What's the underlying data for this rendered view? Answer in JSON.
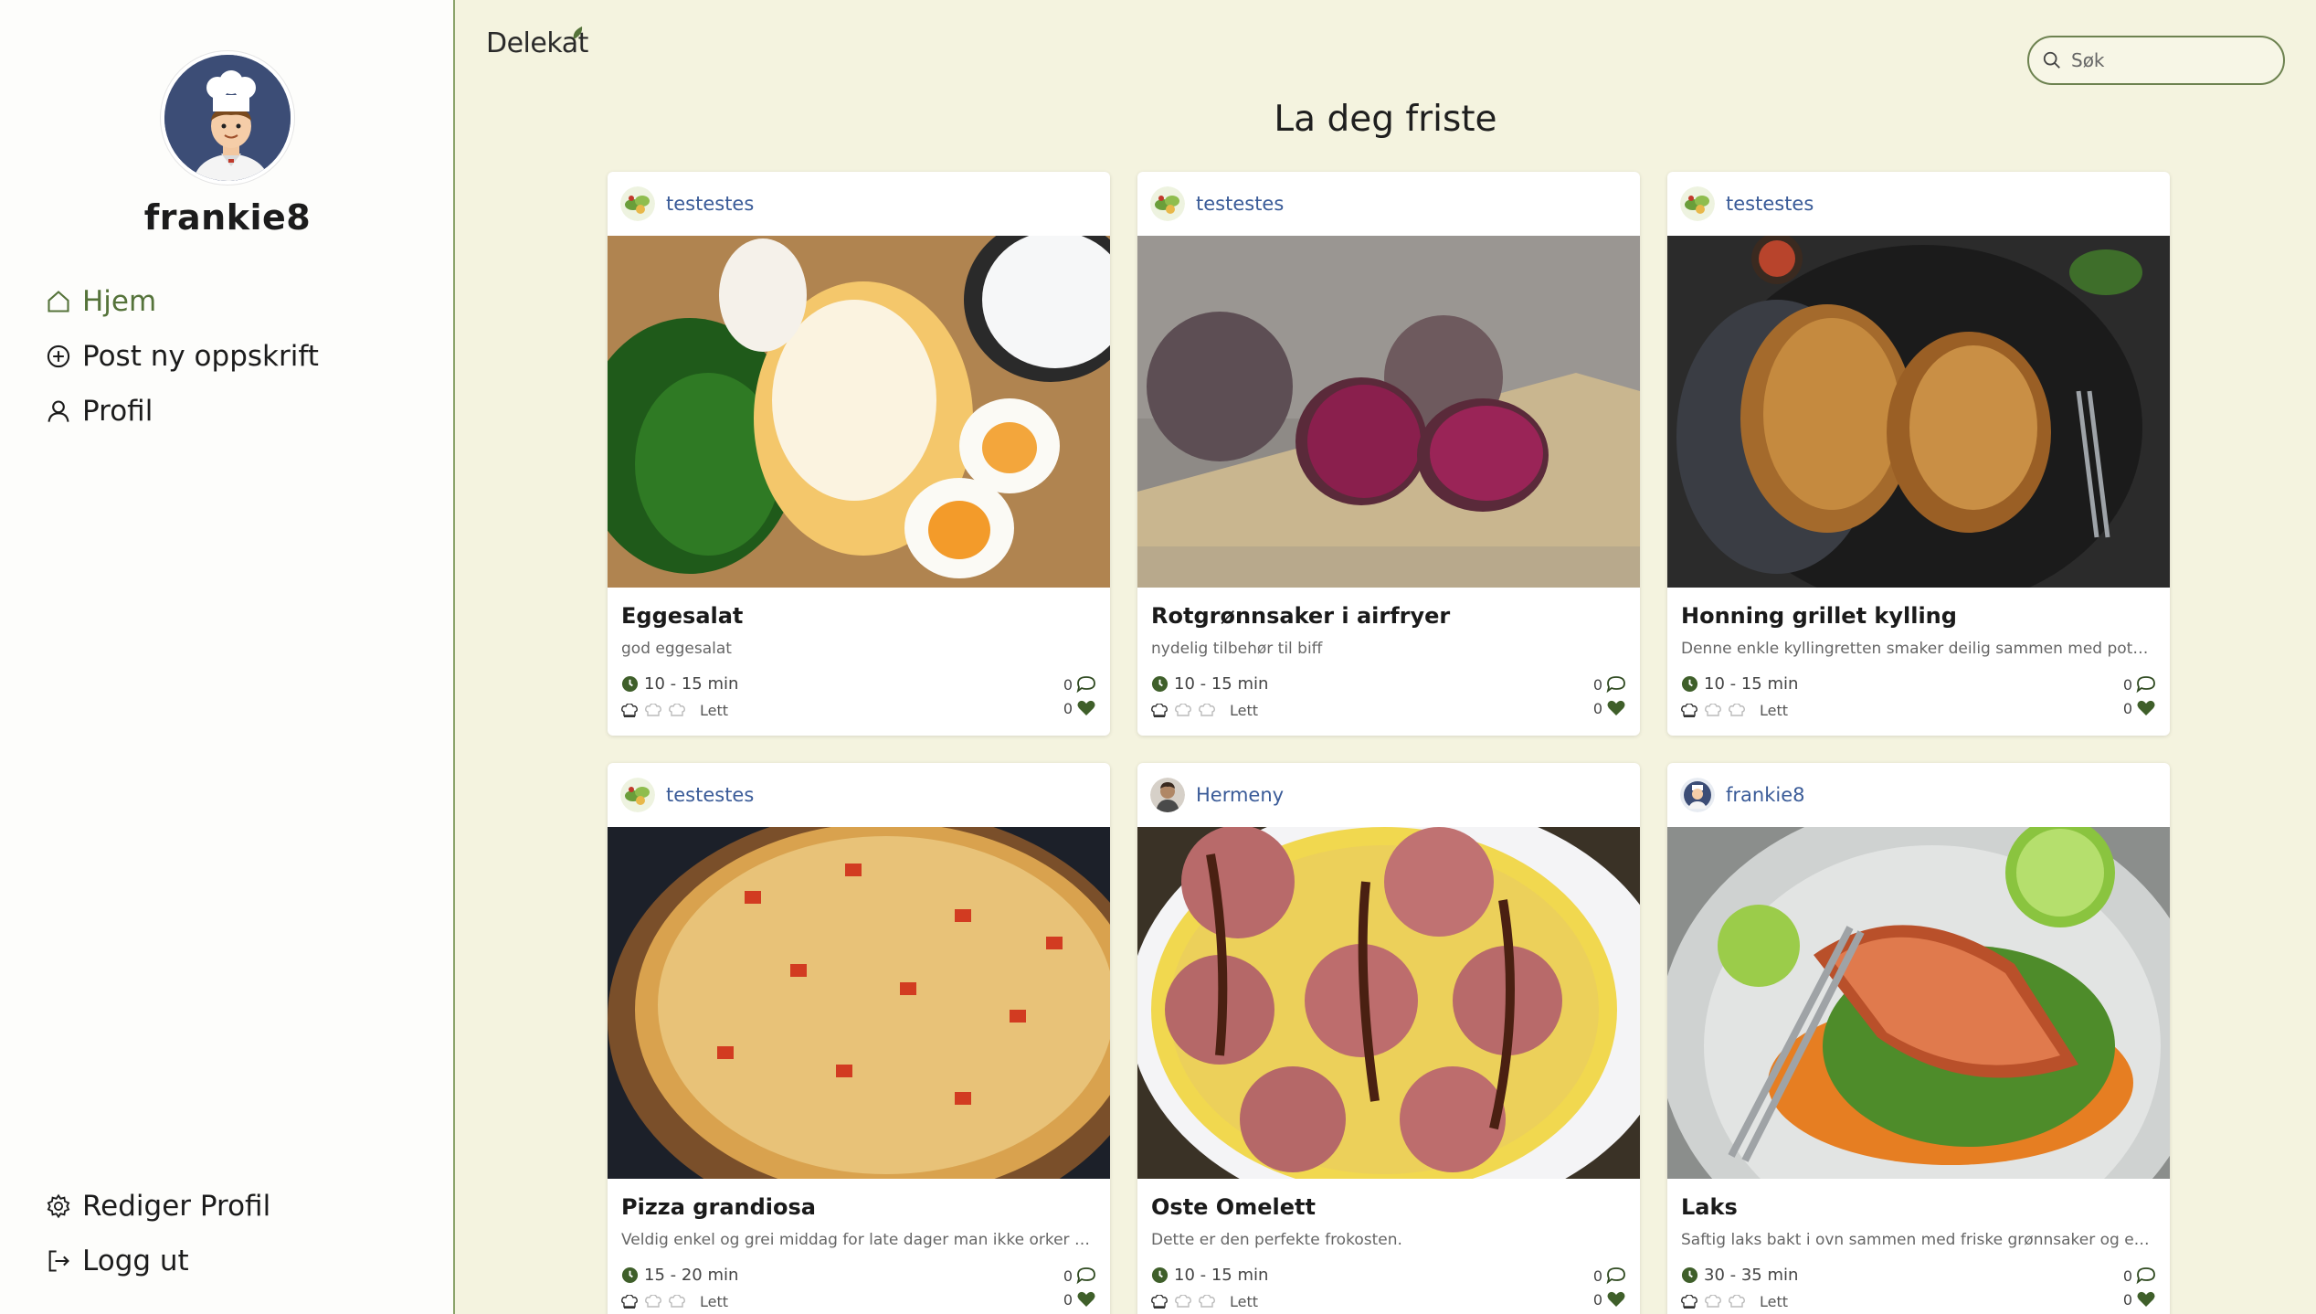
{
  "colors": {
    "accent": "#55733a",
    "background": "#f4f3df",
    "sidebar": "#fdfdfb",
    "link": "#3a5b98"
  },
  "sidebar": {
    "username": "frankie8",
    "nav": [
      {
        "label": "Hjem",
        "icon": "home-icon"
      },
      {
        "label": "Post ny oppskrift",
        "icon": "plus-circle-icon"
      },
      {
        "label": "Profil",
        "icon": "user-icon"
      }
    ],
    "bottom": [
      {
        "label": "Rediger Profil",
        "icon": "gear-icon"
      },
      {
        "label": "Logg ut",
        "icon": "logout-icon"
      }
    ]
  },
  "header": {
    "logo": "Delekat",
    "search_placeholder": "Søk",
    "heading": "La deg friste"
  },
  "cards": [
    {
      "author": "testestes",
      "title": "Eggesalat",
      "desc": "god eggesalat",
      "time": "10 - 15 min",
      "difficulty": "Lett",
      "comments": "0",
      "likes": "0"
    },
    {
      "author": "testestes",
      "title": "Rotgrønnsaker i airfryer",
      "desc": "nydelig tilbehør til biff",
      "time": "10 - 15 min",
      "difficulty": "Lett",
      "comments": "0",
      "likes": "0"
    },
    {
      "author": "testestes",
      "title": "Honning grillet kylling",
      "desc": "Denne enkle kyllingretten smaker deilig sammen med potetmo...",
      "time": "10 - 15 min",
      "difficulty": "Lett",
      "comments": "0",
      "likes": "0"
    },
    {
      "author": "testestes",
      "title": "Pizza grandiosa",
      "desc": "Veldig enkel og grei middag for late dager man ikke orker å lage...",
      "time": "15 - 20 min",
      "difficulty": "Lett",
      "comments": "0",
      "likes": "0"
    },
    {
      "author": "Hermeny",
      "title": "Oste Omelett",
      "desc": "Dette er den perfekte frokosten.",
      "time": "10 - 15 min",
      "difficulty": "Lett",
      "comments": "0",
      "likes": "0"
    },
    {
      "author": "frankie8",
      "title": "Laks",
      "desc": "Saftig laks bakt i ovn sammen med friske grønnsaker og en...",
      "time": "30 - 35 min",
      "difficulty": "Lett",
      "comments": "0",
      "likes": "0"
    }
  ]
}
